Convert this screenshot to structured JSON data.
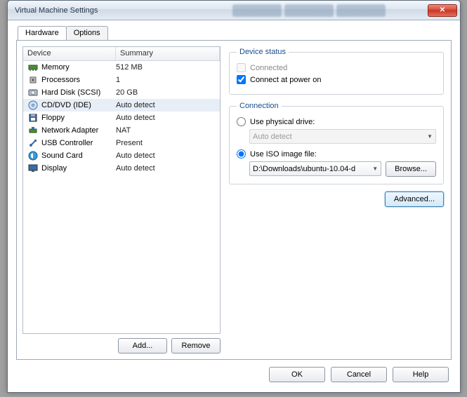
{
  "window": {
    "title": "Virtual Machine Settings",
    "close": "✕"
  },
  "tabs": {
    "hardware": "Hardware",
    "options": "Options"
  },
  "headers": {
    "device": "Device",
    "summary": "Summary"
  },
  "devices": [
    {
      "label": "Memory",
      "summary": "512 MB",
      "icon": "memory"
    },
    {
      "label": "Processors",
      "summary": "1",
      "icon": "cpu"
    },
    {
      "label": "Hard Disk (SCSI)",
      "summary": "20 GB",
      "icon": "hdd"
    },
    {
      "label": "CD/DVD (IDE)",
      "summary": "Auto detect",
      "icon": "cd",
      "selected": true
    },
    {
      "label": "Floppy",
      "summary": "Auto detect",
      "icon": "floppy"
    },
    {
      "label": "Network Adapter",
      "summary": "NAT",
      "icon": "net"
    },
    {
      "label": "USB Controller",
      "summary": "Present",
      "icon": "usb"
    },
    {
      "label": "Sound Card",
      "summary": "Auto detect",
      "icon": "sound"
    },
    {
      "label": "Display",
      "summary": "Auto detect",
      "icon": "display"
    }
  ],
  "buttons": {
    "add": "Add...",
    "remove": "Remove",
    "browse": "Browse...",
    "advanced": "Advanced...",
    "ok": "OK",
    "cancel": "Cancel",
    "help": "Help"
  },
  "status": {
    "legend": "Device status",
    "connected": "Connected",
    "poweron": "Connect at power on",
    "connected_checked": false,
    "poweron_checked": true
  },
  "connection": {
    "legend": "Connection",
    "physical": "Use physical drive:",
    "physical_value": "Auto detect",
    "iso": "Use ISO image file:",
    "iso_value": "D:\\Downloads\\ubuntu-10.04-d",
    "use_iso": true
  }
}
